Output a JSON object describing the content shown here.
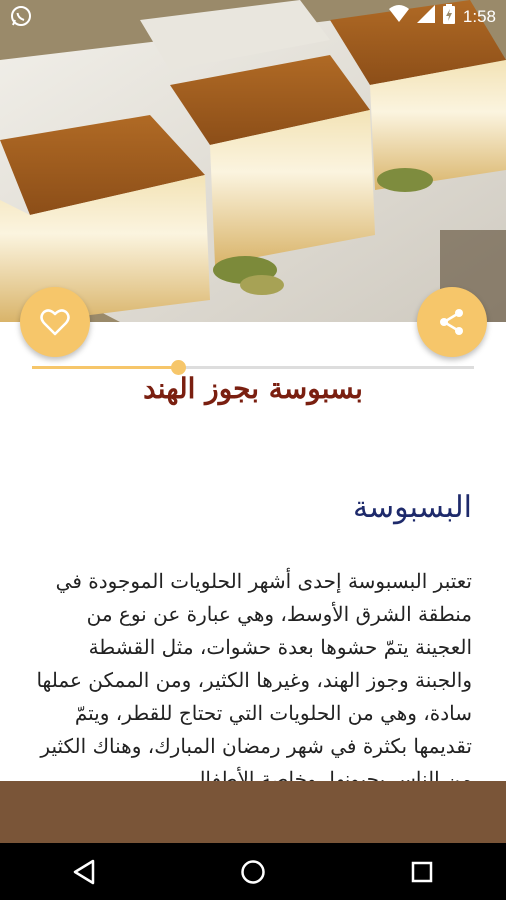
{
  "status_bar": {
    "time": "1:58",
    "icons": [
      "whatsapp-icon",
      "wifi-icon",
      "signal-icon",
      "battery-icon"
    ]
  },
  "hero": {
    "image": "basbousa-photo"
  },
  "actions": {
    "favorite_icon": "heart-icon",
    "share_icon": "share-icon",
    "accent_color": "#f6c66a"
  },
  "reading_progress": {
    "fraction": 0.33
  },
  "article": {
    "title": "بسبوسة بجوز الهند",
    "section_heading": "البسبوسة",
    "body": "تعتبر البسبوسة إحدى أشهر الحلويات الموجودة في منطقة الشرق الأوسط، وهي عبارة عن نوع من العجينة يتمّ حشوها بعدة حشوات، مثل القشطة والجبنة وجوز الهند، وغيرها الكثير، ومن الممكن عملها سادة، وهي من الحلويات التي تحتاج للقطر، ويتمّ تقديمها بكثرة في شهر رمضان المبارك، وهناك الكثير من الناس يحبونها، وخاصة الأطفال"
  },
  "colors": {
    "title": "#7a1f10",
    "heading": "#1e2a6b",
    "footer": "#7a5538"
  },
  "nav_bar": {
    "buttons": [
      "back-icon",
      "home-icon",
      "recents-icon"
    ]
  }
}
